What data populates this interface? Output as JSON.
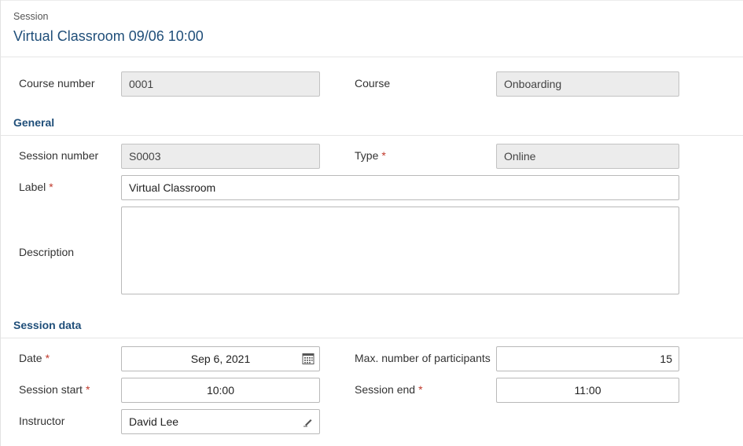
{
  "header": {
    "subtitle": "Session",
    "title": "Virtual Classroom 09/06 10:00"
  },
  "top": {
    "course_number_label": "Course number",
    "course_number_value": "0001",
    "course_label": "Course",
    "course_value": "Onboarding"
  },
  "general": {
    "heading": "General",
    "session_number_label": "Session number",
    "session_number_value": "S0003",
    "type_label": "Type",
    "type_value": "Online",
    "label_label": "Label",
    "label_value": "Virtual Classroom",
    "description_label": "Description",
    "description_value": ""
  },
  "session_data": {
    "heading": "Session data",
    "date_label": "Date",
    "date_value": "Sep 6, 2021",
    "max_participants_label": "Max. number of participants",
    "max_participants_value": "15",
    "session_start_label": "Session start",
    "session_start_value": "10:00",
    "session_end_label": "Session end",
    "session_end_value": "11:00",
    "instructor_label": "Instructor",
    "instructor_value": "David Lee"
  },
  "required_mark": "*",
  "icons": {
    "date_picker": "calendar-icon",
    "instructor_edit": "pencil-icon"
  },
  "colors": {
    "accent": "#1f4e79",
    "required": "#c0392b",
    "readonly_bg": "#ececec"
  }
}
